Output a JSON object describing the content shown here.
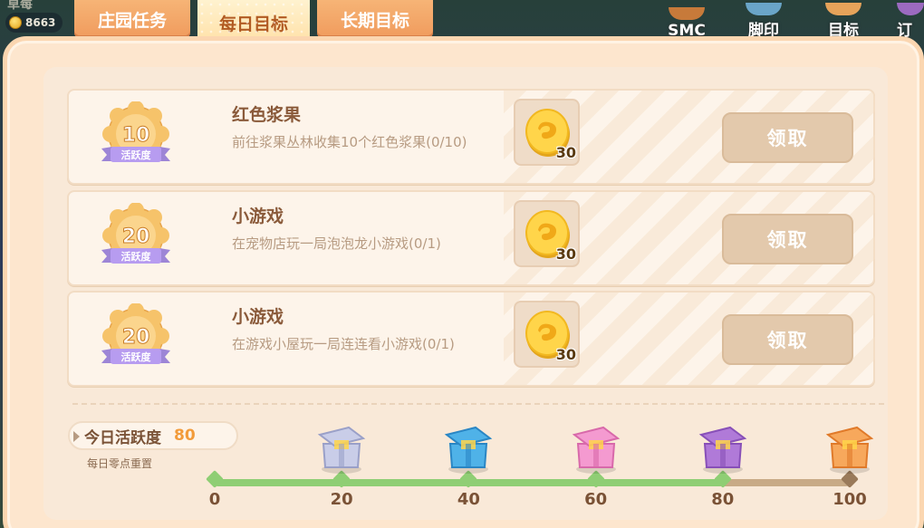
{
  "hud": {
    "coin_amount": "8663",
    "top_text": "草莓",
    "buttons": [
      {
        "label": "SMC",
        "icon": "smc-icon"
      },
      {
        "label": "脚印",
        "icon": "footprint-icon"
      },
      {
        "label": "目标",
        "icon": "target-icon"
      },
      {
        "label": "订",
        "icon": "order-icon"
      }
    ]
  },
  "tabs": [
    {
      "label": "庄园任务",
      "active": false
    },
    {
      "label": "每日目标",
      "active": true
    },
    {
      "label": "长期目标",
      "active": false
    }
  ],
  "tasks": [
    {
      "activity_points": "10",
      "badge_text": "活跃度",
      "title": "红色浆果",
      "description": "前往浆果丛林收集10个红色浆果(0/10)",
      "reward_count": "30",
      "button_label": "领取"
    },
    {
      "activity_points": "20",
      "badge_text": "活跃度",
      "title": "小游戏",
      "description": "在宠物店玩一局泡泡龙小游戏(0/1)",
      "reward_count": "30",
      "button_label": "领取"
    },
    {
      "activity_points": "20",
      "badge_text": "活跃度",
      "title": "小游戏",
      "description": "在游戏小屋玩一局连连看小游戏(0/1)",
      "reward_count": "30",
      "button_label": "领取"
    }
  ],
  "activity": {
    "label": "今日活跃度",
    "value": "80",
    "reset_note": "每日零点重置",
    "progress_fraction": 0.8,
    "milestones": [
      "0",
      "20",
      "40",
      "60",
      "80",
      "100"
    ],
    "chests": [
      "gray-chest-icon",
      "blue-chest-icon",
      "pink-chest-icon",
      "purple-chest-icon",
      "gold-gift-box-icon"
    ]
  },
  "colors": {
    "accent_orange": "#f09b5d",
    "active_tab": "#ffe0a6",
    "progress_green": "#8fce74",
    "button_disabled": "#e3c9ac"
  }
}
